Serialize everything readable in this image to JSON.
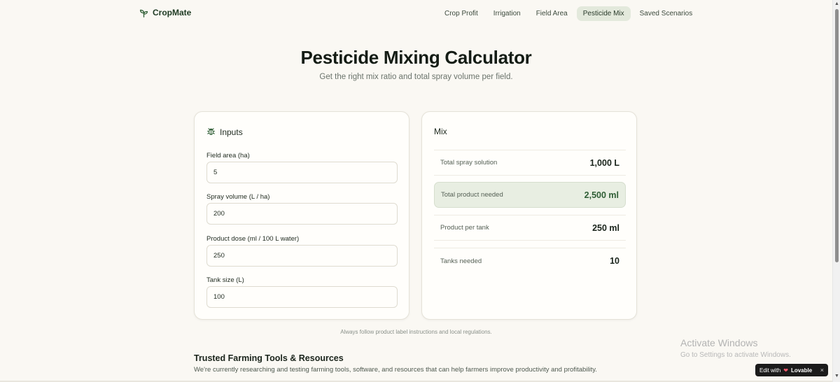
{
  "brand": {
    "name": "CropMate",
    "icon": "sprout-icon"
  },
  "nav": {
    "items": [
      {
        "label": "Crop Profit",
        "active": false
      },
      {
        "label": "Irrigation",
        "active": false
      },
      {
        "label": "Field Area",
        "active": false
      },
      {
        "label": "Pesticide Mix",
        "active": true
      },
      {
        "label": "Saved Scenarios",
        "active": false
      }
    ]
  },
  "hero": {
    "title": "Pesticide Mixing Calculator",
    "subtitle": "Get the right mix ratio and total spray volume per field."
  },
  "inputs": {
    "title": "Inputs",
    "icon": "bug-icon",
    "fields": [
      {
        "label": "Field area (ha)",
        "value": "5"
      },
      {
        "label": "Spray volume (L / ha)",
        "value": "200"
      },
      {
        "label": "Product dose (ml / 100 L water)",
        "value": "250"
      },
      {
        "label": "Tank size (L)",
        "value": "100"
      }
    ]
  },
  "mix": {
    "title": "Mix",
    "rows": [
      {
        "label": "Total spray solution",
        "value": "1,000 L",
        "highlight": false
      },
      {
        "label": "Total product needed",
        "value": "2,500 ml",
        "highlight": true
      },
      {
        "label": "Product per tank",
        "value": "250 ml",
        "highlight": false
      },
      {
        "label": "Tanks needed",
        "value": "10",
        "highlight": false
      }
    ]
  },
  "disclaimer": "Always follow product label instructions and local regulations.",
  "resources": {
    "title": "Trusted Farming Tools & Resources",
    "text": "We're currently researching and testing farming tools, software, and resources that can help farmers improve productivity and profitability."
  },
  "watermark": {
    "title": "Activate Windows",
    "subtitle": "Go to Settings to activate Windows."
  },
  "badge": {
    "prefix": "Edit with",
    "brand": "Lovable",
    "close": "×"
  },
  "colors": {
    "background": "#faf8f3",
    "accent": "#2f5e35",
    "nav_active_bg": "#e3e9dc",
    "highlight_bg": "#e8eee2"
  }
}
